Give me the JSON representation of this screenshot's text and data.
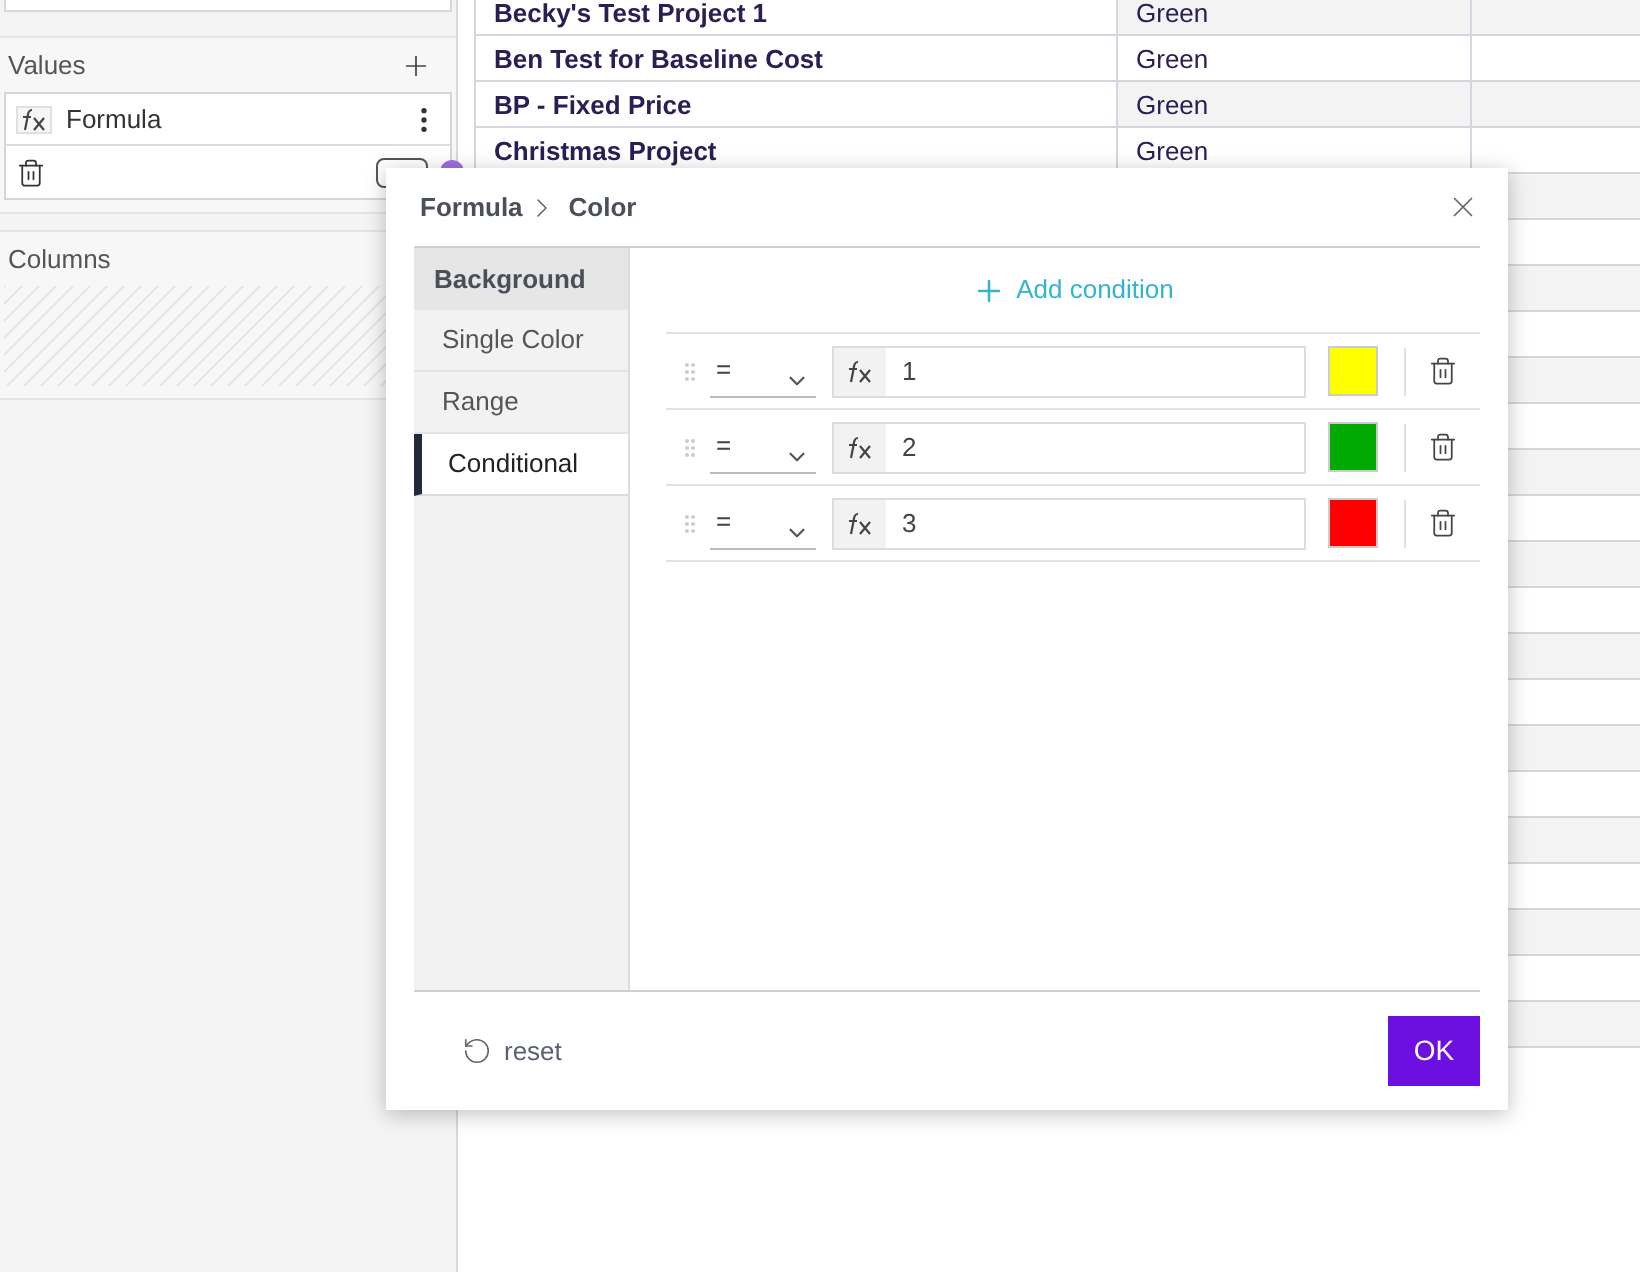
{
  "sidebar": {
    "values_section": {
      "title": "Values",
      "items": [
        {
          "label": "Formula"
        }
      ]
    },
    "columns_section": {
      "title": "Columns"
    }
  },
  "table": {
    "rows": [
      {
        "column_1": "Becky's Test Project 1",
        "column_2": "Green"
      },
      {
        "column_1": "Ben Test for Baseline Cost",
        "column_2": "Green"
      },
      {
        "column_1": "BP - Fixed Price",
        "column_2": "Green"
      },
      {
        "column_1": "Christmas Project",
        "column_2": "Green"
      }
    ]
  },
  "dialog": {
    "breadcrumb": [
      "Formula",
      "Color"
    ],
    "tabs": [
      {
        "label": "Background",
        "kind": "header",
        "selected": false
      },
      {
        "label": "Single Color",
        "kind": "tab",
        "selected": false
      },
      {
        "label": "Range",
        "kind": "tab",
        "selected": false
      },
      {
        "label": "Conditional",
        "kind": "tab",
        "selected": true
      }
    ],
    "add_condition": "Add condition",
    "conditions": [
      {
        "operator": "=",
        "value": "1",
        "color": "#ffff00"
      },
      {
        "operator": "=",
        "value": "2",
        "color": "#00aa00"
      },
      {
        "operator": "=",
        "value": "3",
        "color": "#ff0000"
      }
    ],
    "reset": "reset",
    "ok": "OK"
  }
}
